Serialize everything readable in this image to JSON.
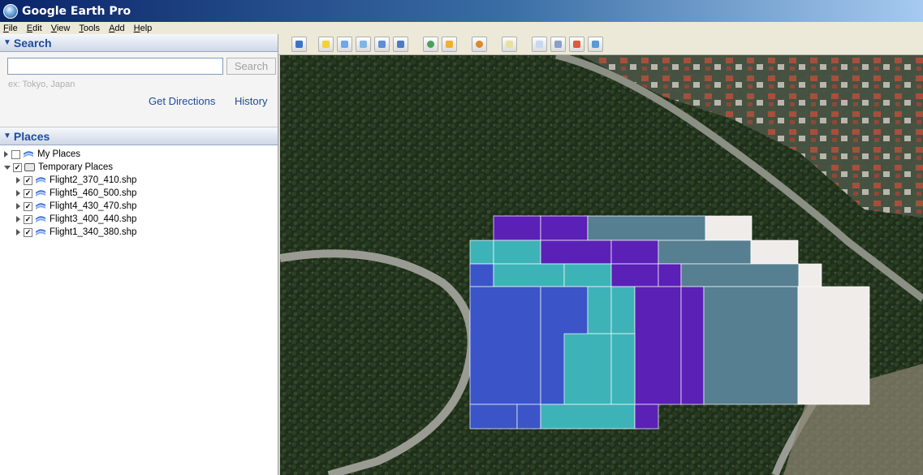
{
  "window": {
    "title": "Google Earth Pro"
  },
  "menu": [
    "File",
    "Edit",
    "View",
    "Tools",
    "Add",
    "Help"
  ],
  "search": {
    "header": "Search",
    "input_value": "",
    "button_label": "Search",
    "hint": "ex: Tokyo, Japan",
    "get_directions": "Get Directions",
    "history": "History"
  },
  "places": {
    "header": "Places",
    "items": [
      {
        "label": "My Places",
        "checked": false,
        "expanded": false
      },
      {
        "label": "Temporary Places",
        "checked": true,
        "expanded": true
      },
      {
        "label": "Flight2_370_410.shp",
        "checked": true,
        "expanded": false
      },
      {
        "label": "Flight5_460_500.shp",
        "checked": true,
        "expanded": false
      },
      {
        "label": "Flight4_430_470.shp",
        "checked": true,
        "expanded": false
      },
      {
        "label": "Flight3_400_440.shp",
        "checked": true,
        "expanded": false
      },
      {
        "label": "Flight1_340_380.shp",
        "checked": true,
        "expanded": false
      }
    ]
  },
  "toolbar_icons": [
    "sidebar-toggle-icon",
    "placemark-icon",
    "polygon-icon",
    "path-icon",
    "image-overlay-icon",
    "record-tour-icon",
    "historical-imagery-icon",
    "sunlight-icon",
    "planets-icon",
    "ruler-icon",
    "email-icon",
    "print-icon",
    "view-in-maps-icon",
    "save-image-icon"
  ],
  "colors": {
    "flight_purple": "#5b20b6",
    "flight_teal": "#3db3b8",
    "flight_blue": "#3b55c8",
    "flight_slate": "#567f91",
    "flight_white": "#f0ecea",
    "link_blue": "#1f4b9c"
  }
}
